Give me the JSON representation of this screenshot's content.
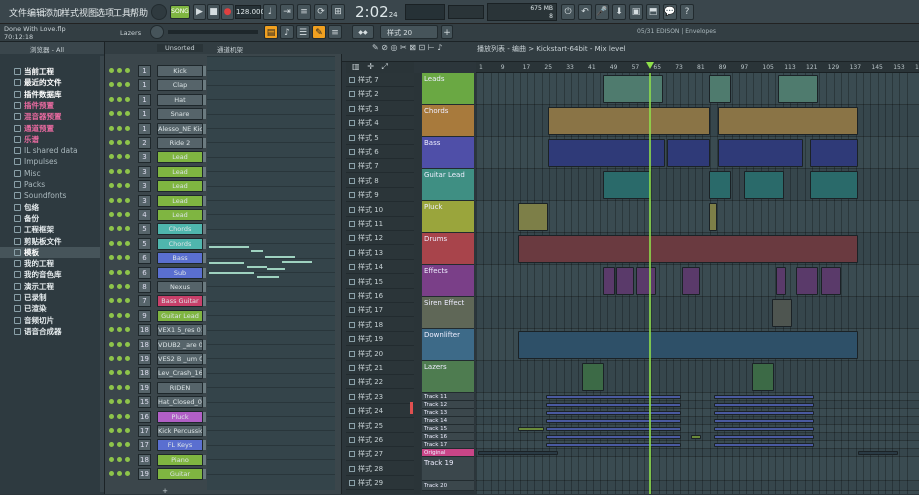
{
  "menu": [
    "文件",
    "编辑",
    "添加",
    "样式",
    "视图",
    "选项",
    "工具",
    "帮助"
  ],
  "transport": {
    "song_label": "SONG",
    "tempo": "128.000",
    "time": "2:02",
    "time_sub": "24",
    "cpu_label": "675 MB",
    "cpu_sub": "8"
  },
  "project": {
    "name": "Done With Love.flp",
    "time": "70:12:18",
    "tool_hint": "Lazers"
  },
  "hint_panel": {
    "text": "05/31  EDISON | Envelopes"
  },
  "browser": {
    "title": "浏览器 - All",
    "items": [
      {
        "label": "当前工程",
        "color": "#ffffff",
        "bold": true
      },
      {
        "label": "最近的文件",
        "color": "#ffffff",
        "bold": true
      },
      {
        "label": "插件数据库",
        "color": "#ffffff",
        "bold": true
      },
      {
        "label": "插件预置",
        "color": "#e86aa0",
        "bold": true
      },
      {
        "label": "混音器预置",
        "color": "#e86aa0",
        "bold": true
      },
      {
        "label": "通道预置",
        "color": "#e86aa0",
        "bold": true
      },
      {
        "label": "乐谱",
        "color": "#e86aa0",
        "bold": true
      },
      {
        "label": "IL shared data",
        "color": "#aab8bd",
        "bold": false
      },
      {
        "label": "Impulses",
        "color": "#aab8bd",
        "bold": false
      },
      {
        "label": "Misc",
        "color": "#aab8bd",
        "bold": false
      },
      {
        "label": "Packs",
        "color": "#aab8bd",
        "bold": false
      },
      {
        "label": "Soundfonts",
        "color": "#aab8bd",
        "bold": false
      },
      {
        "label": "包络",
        "color": "#e6ecee",
        "bold": true
      },
      {
        "label": "备份",
        "color": "#e6ecee",
        "bold": true
      },
      {
        "label": "工程框架",
        "color": "#e6ecee",
        "bold": true
      },
      {
        "label": "剪贴板文件",
        "color": "#e6ecee",
        "bold": true
      },
      {
        "label": "模板",
        "color": "#ffffff",
        "bold": true
      },
      {
        "label": "我的工程",
        "color": "#e6ecee",
        "bold": true
      },
      {
        "label": "我的音色库",
        "color": "#e6ecee",
        "bold": true
      },
      {
        "label": "演示工程",
        "color": "#e6ecee",
        "bold": true
      },
      {
        "label": "已录制",
        "color": "#e6ecee",
        "bold": true
      },
      {
        "label": "已渲染",
        "color": "#e6ecee",
        "bold": true
      },
      {
        "label": "音频切片",
        "color": "#e6ecee",
        "bold": true
      },
      {
        "label": "语音合成器",
        "color": "#e6ecee",
        "bold": true
      }
    ]
  },
  "rack": {
    "filter": "Unsorted",
    "title": "通道机架",
    "channels": [
      {
        "n": "1",
        "name": "Kick",
        "color": "#56646a"
      },
      {
        "n": "1",
        "name": "Clap",
        "color": "#56646a"
      },
      {
        "n": "1",
        "name": "Hat",
        "color": "#56646a"
      },
      {
        "n": "1",
        "name": "Snare",
        "color": "#56646a"
      },
      {
        "n": "1",
        "name": "Alesso_NE Kick",
        "color": "#56646a"
      },
      {
        "n": "2",
        "name": "Ride 2",
        "color": "#56646a"
      },
      {
        "n": "3",
        "name": "Lead",
        "color": "#7fb541"
      },
      {
        "n": "3",
        "name": "Lead",
        "color": "#7fb541"
      },
      {
        "n": "3",
        "name": "Lead",
        "color": "#7fb541"
      },
      {
        "n": "3",
        "name": "Lead",
        "color": "#7fb541"
      },
      {
        "n": "4",
        "name": "Lead",
        "color": "#7fb541"
      },
      {
        "n": "5",
        "name": "Chords",
        "color": "#4fb6ad"
      },
      {
        "n": "5",
        "name": "Chords",
        "color": "#4fb6ad"
      },
      {
        "n": "6",
        "name": "Bass",
        "color": "#5a6fd0"
      },
      {
        "n": "6",
        "name": "Sub",
        "color": "#5a6fd0"
      },
      {
        "n": "8",
        "name": "Nexus",
        "color": "#56646a"
      },
      {
        "n": "7",
        "name": "Bass Guitar",
        "color": "#c8406a"
      },
      {
        "n": "9",
        "name": "Guitar Lead",
        "color": "#7fb541"
      },
      {
        "n": "18",
        "name": "VEX1 5_res 017",
        "color": "#56646a"
      },
      {
        "n": "18",
        "name": "VDUB2 _are 001",
        "color": "#56646a"
      },
      {
        "n": "19",
        "name": "VES2 B _um 066",
        "color": "#56646a"
      },
      {
        "n": "18",
        "name": "Lev_Crash_16",
        "color": "#56646a"
      },
      {
        "n": "19",
        "name": "RIDEN",
        "color": "#56646a"
      },
      {
        "n": "15",
        "name": "Hat_Closed_05",
        "color": "#56646a"
      },
      {
        "n": "16",
        "name": "Pluck",
        "color": "#b15fc6"
      },
      {
        "n": "17",
        "name": "Kick Percussion",
        "color": "#56646a"
      },
      {
        "n": "17",
        "name": "FL Keys",
        "color": "#5a6fd0"
      },
      {
        "n": "18",
        "name": "Piano",
        "color": "#7fb541"
      },
      {
        "n": "19",
        "name": "Guitar",
        "color": "#7fb541"
      }
    ]
  },
  "playlist": {
    "title": "播放列表 - 编曲  >  Kickstart-64bit - Mix level",
    "pattern_selector": "样式 20",
    "ruler": [
      "1",
      "9",
      "17",
      "25",
      "33",
      "41",
      "49",
      "57",
      "65",
      "73",
      "81",
      "89",
      "97",
      "105",
      "113",
      "121",
      "129",
      "137",
      "145",
      "153",
      "161"
    ],
    "patterns": [
      "样式 7",
      "样式 2",
      "样式 3",
      "样式 4",
      "样式 5",
      "样式 6",
      "样式 7",
      "样式 8",
      "样式 9",
      "样式 10",
      "样式 11",
      "样式 12",
      "样式 13",
      "样式 14",
      "样式 15",
      "样式 16",
      "样式 17",
      "样式 18",
      "样式 19",
      "样式 20",
      "样式 21",
      "样式 22",
      "样式 23",
      "样式 24",
      "样式 25",
      "样式 26",
      "样式 27",
      "样式 28",
      "样式 29"
    ],
    "tracks": [
      {
        "name": "Leads",
        "color": "#6aa843",
        "h": 32
      },
      {
        "name": "Chords",
        "color": "#a87a3c",
        "h": 32
      },
      {
        "name": "Bass",
        "color": "#4f4fa8",
        "h": 32
      },
      {
        "name": "Guitar Lead",
        "color": "#3f8f83",
        "h": 32
      },
      {
        "name": "Pluck",
        "color": "#9aa53c",
        "h": 32
      },
      {
        "name": "Drums",
        "color": "#a8444b",
        "h": 32
      },
      {
        "name": "Effects",
        "color": "#7a3f88",
        "h": 32
      },
      {
        "name": "Siren Effect",
        "color": "#5f6757",
        "h": 32
      },
      {
        "name": "Downlifter",
        "color": "#3d6a88",
        "h": 32
      },
      {
        "name": "Lazers",
        "color": "#4e7c50",
        "h": 32
      },
      {
        "name": "Track 11",
        "color": "#3b474c",
        "h": 8
      },
      {
        "name": "Track 12",
        "color": "#3b474c",
        "h": 8
      },
      {
        "name": "Track 13",
        "color": "#3b474c",
        "h": 8
      },
      {
        "name": "Track 14",
        "color": "#3b474c",
        "h": 8
      },
      {
        "name": "Track 15",
        "color": "#3b474c",
        "h": 8
      },
      {
        "name": "Track 16",
        "color": "#3b474c",
        "h": 8
      },
      {
        "name": "Track 17",
        "color": "#3b474c",
        "h": 8
      },
      {
        "name": "Original",
        "color": "#c94587",
        "h": 8
      },
      {
        "name": "Track 19",
        "color": "#3b474c",
        "h": 24
      },
      {
        "name": "Track 20",
        "color": "#3b474c",
        "h": 10
      }
    ]
  },
  "colors": {
    "accent": "#f0a020",
    "playhead": "#8ee04a",
    "bg": "#2c363b"
  }
}
